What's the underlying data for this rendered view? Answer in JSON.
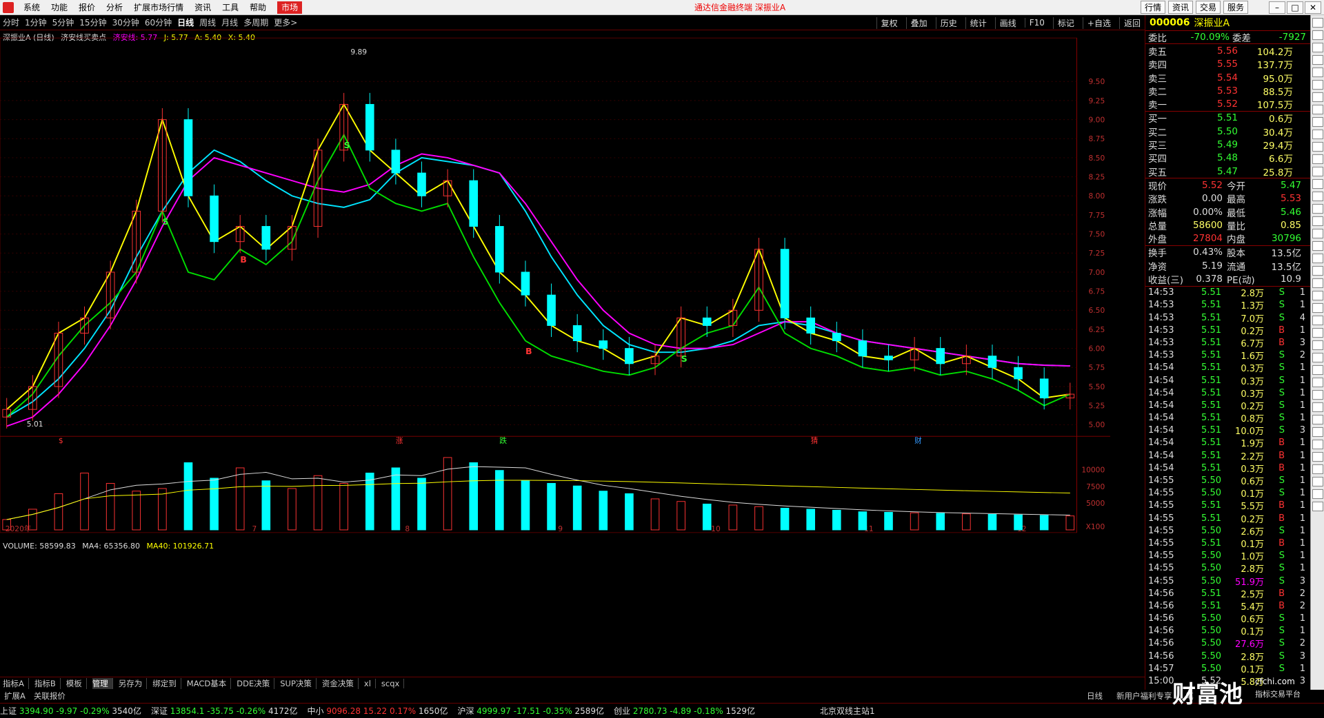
{
  "titlebar": {
    "menu": [
      "系统",
      "功能",
      "报价",
      "分析",
      "扩展市场行情",
      "资讯",
      "工具",
      "帮助",
      "市场"
    ],
    "center_text": "通达信金融终端  深振业A",
    "right_buttons": [
      "行情",
      "资讯",
      "交易",
      "服务"
    ]
  },
  "periodbar": {
    "periods": [
      "分时",
      "1分钟",
      "5分钟",
      "15分钟",
      "30分钟",
      "60分钟",
      "日线",
      "周线",
      "月线",
      "多周期",
      "更多>"
    ],
    "active": "日线",
    "tools": [
      "复权",
      "叠加",
      "历史",
      "统计",
      "画线",
      "F10",
      "标记",
      "+自选",
      "返回"
    ]
  },
  "chart_info": {
    "stock": "深振业A (日线)",
    "indicator": "济安线买卖点",
    "line1": "济安线: 5.77",
    "line2": "J: 5.77",
    "line3": "A: 5.40",
    "line4": "X: 5.40"
  },
  "vol_info": {
    "label": "VOLUME: 58599.83",
    "ma4": "MA4: 65356.80",
    "ma40": "MA40: 101926.71"
  },
  "chart_data": {
    "type": "line",
    "title": "深振业A (日线)",
    "y_ticks": [
      "9.50",
      "9.25",
      "9.00",
      "8.75",
      "8.50",
      "8.25",
      "8.00",
      "7.75",
      "7.50",
      "7.25",
      "7.00",
      "6.75",
      "6.50",
      "6.25",
      "6.00",
      "5.75",
      "5.50",
      "5.25",
      "5.00"
    ],
    "ylim": [
      4.9,
      10.0
    ],
    "high_label": "9.89",
    "low_label": "5.01",
    "x_labels": [
      "2020年",
      "7",
      "8",
      "9",
      "10",
      "11",
      "12"
    ],
    "event_markers": [
      "$",
      "涨",
      "跌",
      "猜",
      "财"
    ],
    "signal_markers": [
      "S",
      "B",
      "S",
      "B",
      "S"
    ],
    "series": [
      {
        "name": "济安线",
        "color": "#00e5ff",
        "values": [
          5.1,
          5.3,
          5.6,
          6.0,
          6.5,
          7.2,
          7.8,
          8.3,
          8.6,
          8.45,
          8.2,
          8.0,
          7.9,
          7.85,
          7.95,
          8.3,
          8.5,
          8.45,
          8.4,
          8.3,
          7.8,
          7.2,
          6.7,
          6.3,
          6.05,
          5.95,
          5.95,
          6.0,
          6.1,
          6.3,
          6.35,
          6.3,
          6.2,
          6.1,
          6.05,
          6.0,
          5.95,
          5.9,
          5.85,
          5.8,
          5.78,
          5.77
        ]
      },
      {
        "name": "J",
        "color": "#ff00ff",
        "values": [
          4.98,
          5.1,
          5.4,
          5.8,
          6.3,
          6.9,
          7.6,
          8.2,
          8.5,
          8.4,
          8.3,
          8.2,
          8.1,
          8.05,
          8.15,
          8.4,
          8.55,
          8.5,
          8.4,
          8.3,
          7.9,
          7.4,
          6.9,
          6.5,
          6.2,
          6.05,
          6.0,
          6.0,
          6.05,
          6.2,
          6.35,
          6.35,
          6.2,
          6.1,
          6.05,
          6.0,
          5.95,
          5.9,
          5.85,
          5.8,
          5.78,
          5.77
        ]
      },
      {
        "name": "A",
        "color": "#ffff00",
        "values": [
          5.2,
          5.5,
          6.2,
          6.4,
          7.0,
          7.8,
          9.0,
          8.0,
          7.4,
          7.6,
          7.3,
          7.6,
          8.6,
          9.2,
          8.6,
          8.3,
          8.0,
          8.2,
          7.6,
          7.0,
          6.7,
          6.3,
          6.1,
          6.0,
          5.8,
          5.9,
          6.4,
          6.3,
          6.5,
          7.3,
          6.4,
          6.2,
          6.1,
          5.9,
          5.85,
          6.0,
          5.8,
          5.9,
          5.75,
          5.6,
          5.35,
          5.4
        ]
      },
      {
        "name": "X",
        "color": "#00dd00",
        "values": [
          5.1,
          5.4,
          5.9,
          6.3,
          6.6,
          7.0,
          7.8,
          7.0,
          6.9,
          7.3,
          7.1,
          7.4,
          8.2,
          8.8,
          8.1,
          7.9,
          7.8,
          7.9,
          7.2,
          6.6,
          6.1,
          5.9,
          5.8,
          5.7,
          5.65,
          5.75,
          6.0,
          6.2,
          6.3,
          6.8,
          6.2,
          6.0,
          5.9,
          5.75,
          5.7,
          5.75,
          5.65,
          5.7,
          5.6,
          5.45,
          5.25,
          5.4
        ]
      }
    ],
    "volume": {
      "ylabels": [
        "10000",
        "7500",
        "5000",
        "X100"
      ],
      "values": [
        20,
        40,
        70,
        110,
        90,
        75,
        80,
        130,
        100,
        120,
        95,
        80,
        105,
        90,
        110,
        120,
        100,
        140,
        130,
        115,
        95,
        90,
        85,
        75,
        70,
        60,
        55,
        50,
        48,
        45,
        42,
        40,
        38,
        35,
        34,
        33,
        32,
        31,
        30,
        29,
        28,
        27
      ]
    }
  },
  "right_panel": {
    "code": "000006",
    "name": "深振业A",
    "weibi_label": "委比",
    "weibi_value": "-70.09%",
    "weicha_label": "委差",
    "weicha_value": "-7927",
    "sells": [
      {
        "label": "卖五",
        "price": "5.56",
        "vol": "104.2万"
      },
      {
        "label": "卖四",
        "price": "5.55",
        "vol": "137.7万"
      },
      {
        "label": "卖三",
        "price": "5.54",
        "vol": "95.0万"
      },
      {
        "label": "卖二",
        "price": "5.53",
        "vol": "88.5万"
      },
      {
        "label": "卖一",
        "price": "5.52",
        "vol": "107.5万"
      }
    ],
    "buys": [
      {
        "label": "买一",
        "price": "5.51",
        "vol": "0.6万"
      },
      {
        "label": "买二",
        "price": "5.50",
        "vol": "30.4万"
      },
      {
        "label": "买三",
        "price": "5.49",
        "vol": "29.4万"
      },
      {
        "label": "买四",
        "price": "5.48",
        "vol": "6.6万"
      },
      {
        "label": "买五",
        "price": "5.47",
        "vol": "25.8万"
      }
    ],
    "quote": [
      {
        "l1": "现价",
        "v1": "5.52",
        "l2": "今开",
        "v2": "5.47"
      },
      {
        "l1": "涨跌",
        "v1": "0.00",
        "l2": "最高",
        "v2": "5.53"
      },
      {
        "l1": "涨幅",
        "v1": "0.00%",
        "l2": "最低",
        "v2": "5.46"
      },
      {
        "l1": "总量",
        "v1": "58600",
        "l2": "量比",
        "v2": "0.85"
      },
      {
        "l1": "外盘",
        "v1": "27804",
        "l2": "内盘",
        "v2": "30796"
      }
    ],
    "fund": [
      {
        "l1": "换手",
        "v1": "0.43%",
        "l2": "股本",
        "v2": "13.5亿"
      },
      {
        "l1": "净资",
        "v1": "5.19",
        "l2": "流通",
        "v2": "13.5亿"
      },
      {
        "l1": "收益(三)",
        "v1": "0.378",
        "l2": "PE(动)",
        "v2": "10.9"
      }
    ],
    "ticks": [
      {
        "t": "14:53",
        "p": "5.51",
        "v": "2.8万",
        "d": "S",
        "n": "1"
      },
      {
        "t": "14:53",
        "p": "5.51",
        "v": "1.3万",
        "d": "S",
        "n": "1"
      },
      {
        "t": "14:53",
        "p": "5.51",
        "v": "7.0万",
        "d": "S",
        "n": "4"
      },
      {
        "t": "14:53",
        "p": "5.51",
        "v": "0.2万",
        "d": "B",
        "n": "1"
      },
      {
        "t": "14:53",
        "p": "5.51",
        "v": "6.7万",
        "d": "B",
        "n": "3"
      },
      {
        "t": "14:53",
        "p": "5.51",
        "v": "1.6万",
        "d": "S",
        "n": "2"
      },
      {
        "t": "14:54",
        "p": "5.51",
        "v": "0.3万",
        "d": "S",
        "n": "1"
      },
      {
        "t": "14:54",
        "p": "5.51",
        "v": "0.3万",
        "d": "S",
        "n": "1"
      },
      {
        "t": "14:54",
        "p": "5.51",
        "v": "0.3万",
        "d": "S",
        "n": "1"
      },
      {
        "t": "14:54",
        "p": "5.51",
        "v": "0.2万",
        "d": "S",
        "n": "1"
      },
      {
        "t": "14:54",
        "p": "5.51",
        "v": "0.8万",
        "d": "S",
        "n": "1"
      },
      {
        "t": "14:54",
        "p": "5.51",
        "v": "10.0万",
        "d": "S",
        "n": "3"
      },
      {
        "t": "14:54",
        "p": "5.51",
        "v": "1.9万",
        "d": "B",
        "n": "1"
      },
      {
        "t": "14:54",
        "p": "5.51",
        "v": "2.2万",
        "d": "B",
        "n": "1"
      },
      {
        "t": "14:54",
        "p": "5.51",
        "v": "0.3万",
        "d": "B",
        "n": "1"
      },
      {
        "t": "14:55",
        "p": "5.50",
        "v": "0.6万",
        "d": "S",
        "n": "1"
      },
      {
        "t": "14:55",
        "p": "5.50",
        "v": "0.1万",
        "d": "S",
        "n": "1"
      },
      {
        "t": "14:55",
        "p": "5.51",
        "v": "5.5万",
        "d": "B",
        "n": "1"
      },
      {
        "t": "14:55",
        "p": "5.51",
        "v": "0.2万",
        "d": "B",
        "n": "1"
      },
      {
        "t": "14:55",
        "p": "5.50",
        "v": "2.6万",
        "d": "S",
        "n": "1"
      },
      {
        "t": "14:55",
        "p": "5.51",
        "v": "0.1万",
        "d": "B",
        "n": "1"
      },
      {
        "t": "14:55",
        "p": "5.50",
        "v": "1.0万",
        "d": "S",
        "n": "1"
      },
      {
        "t": "14:55",
        "p": "5.50",
        "v": "2.8万",
        "d": "S",
        "n": "1"
      },
      {
        "t": "14:55",
        "p": "5.50",
        "v": "51.9万",
        "d": "S",
        "n": "3"
      },
      {
        "t": "14:56",
        "p": "5.51",
        "v": "2.5万",
        "d": "B",
        "n": "2"
      },
      {
        "t": "14:56",
        "p": "5.51",
        "v": "5.4万",
        "d": "B",
        "n": "2"
      },
      {
        "t": "14:56",
        "p": "5.50",
        "v": "0.6万",
        "d": "S",
        "n": "1"
      },
      {
        "t": "14:56",
        "p": "5.50",
        "v": "0.1万",
        "d": "S",
        "n": "1"
      },
      {
        "t": "14:56",
        "p": "5.50",
        "v": "27.6万",
        "d": "S",
        "n": "2"
      },
      {
        "t": "14:56",
        "p": "5.50",
        "v": "2.8万",
        "d": "S",
        "n": "3"
      },
      {
        "t": "14:57",
        "p": "5.50",
        "v": "0.1万",
        "d": "S",
        "n": "1"
      },
      {
        "t": "15:00",
        "p": "5.52",
        "v": "5.8万",
        "d": "",
        "n": "3"
      }
    ]
  },
  "tabs": [
    "指标A",
    "指标B",
    "模板",
    "管理",
    "另存为",
    "绑定到",
    "MACD基本",
    "DDE决策",
    "SUP决策",
    "资金决策",
    "xl",
    "scqx"
  ],
  "active_tab": "管理",
  "subbar": [
    "扩展A",
    "关联报价"
  ],
  "subbar_right": [
    "日线",
    "新用户福利专享",
    "笔"
  ],
  "statusbar": [
    {
      "name": "上证",
      "val": "3394.90",
      "chg": "-9.97",
      "pct": "-0.29%",
      "amt": "3540亿",
      "dir": "dn"
    },
    {
      "name": "深证",
      "val": "13854.1",
      "chg": "-35.75",
      "pct": "-0.26%",
      "amt": "4172亿",
      "dir": "dn"
    },
    {
      "name": "中小",
      "val": "9096.28",
      "chg": "15.22",
      "pct": "0.17%",
      "amt": "1650亿",
      "dir": "up"
    },
    {
      "name": "沪深",
      "val": "4999.97",
      "chg": "-17.51",
      "pct": "-0.35%",
      "amt": "2589亿",
      "dir": "dn"
    },
    {
      "name": "创业",
      "val": "2780.73",
      "chg": "-4.89",
      "pct": "-0.18%",
      "amt": "1529亿",
      "dir": "dn"
    }
  ],
  "status_station": "北京双线主站1",
  "brand": {
    "name": "财富池",
    "url": "cfchi.com",
    "sub": "指标交易平台"
  },
  "colors": {
    "up": "#ff3333",
    "down": "#00ffff",
    "j_line": "#ff00ff",
    "x_line": "#00dd00",
    "a_line": "#ffff00",
    "ji_line": "#00e5ff",
    "grid": "#5a0000"
  }
}
